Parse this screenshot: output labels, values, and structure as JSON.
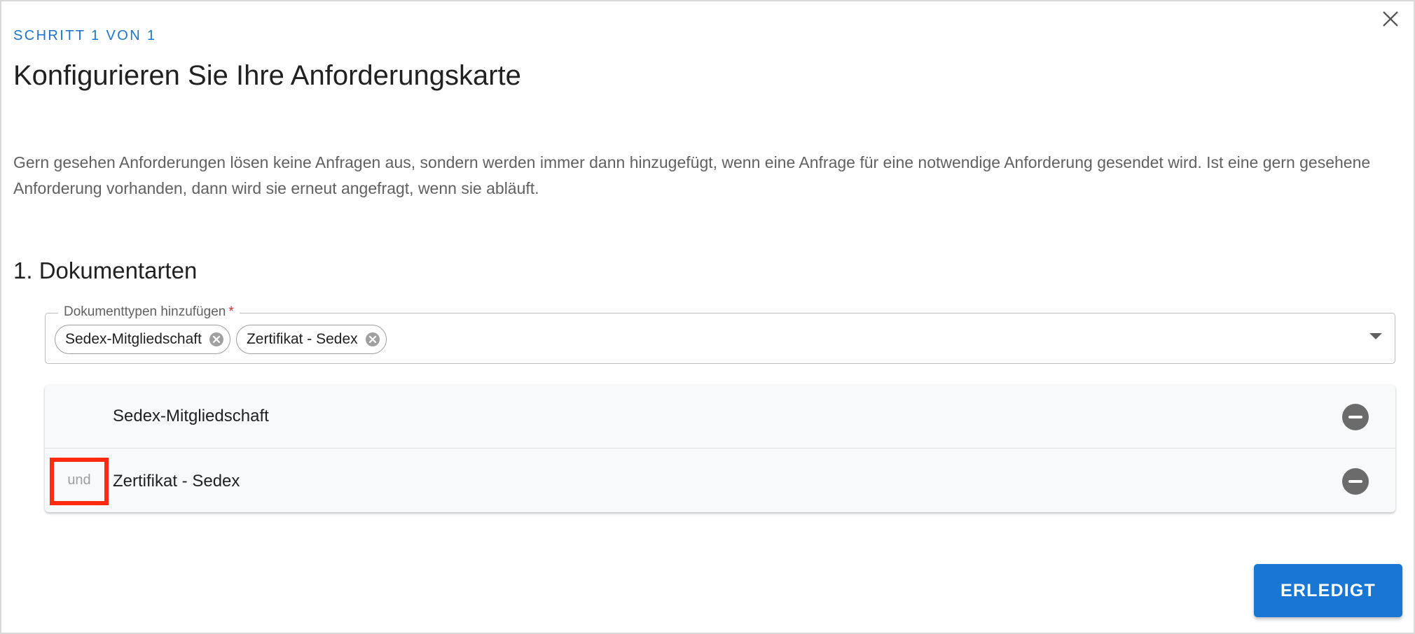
{
  "dialog": {
    "step": "SCHRITT 1 VON 1",
    "title": "Konfigurieren Sie Ihre Anforderungskarte",
    "description": "Gern gesehen Anforderungen lösen keine Anfragen aus, sondern werden immer dann hinzugefügt, wenn eine Anfrage für eine notwendige Anforderung gesendet wird. Ist eine gern gesehene Anforderung vorhanden, dann wird sie erneut angefragt, wenn sie abläuft.",
    "close_icon": "close-icon"
  },
  "section": {
    "title": "1. Dokumentarten"
  },
  "select": {
    "label": "Dokumenttypen hinzufügen",
    "required_mark": "*",
    "chips": [
      {
        "label": "Sedex-Mitgliedschaft",
        "icon": "cancel-circle-icon"
      },
      {
        "label": "Zertifikat - Sedex",
        "icon": "cancel-circle-icon"
      }
    ],
    "arrow_icon": "dropdown-arrow-icon"
  },
  "list": {
    "rows": [
      {
        "label": "Sedex-Mitgliedschaft",
        "connector": "",
        "icon": "remove-circle-icon"
      },
      {
        "label": "Zertifikat - Sedex",
        "connector": "und",
        "icon": "remove-circle-icon"
      }
    ]
  },
  "footer": {
    "done_label": "ERLEDIGT"
  },
  "colors": {
    "accent": "#1976d2",
    "required": "#d32f2f",
    "highlight": "#ff2a10",
    "remove_icon": "#6b6b6b"
  }
}
